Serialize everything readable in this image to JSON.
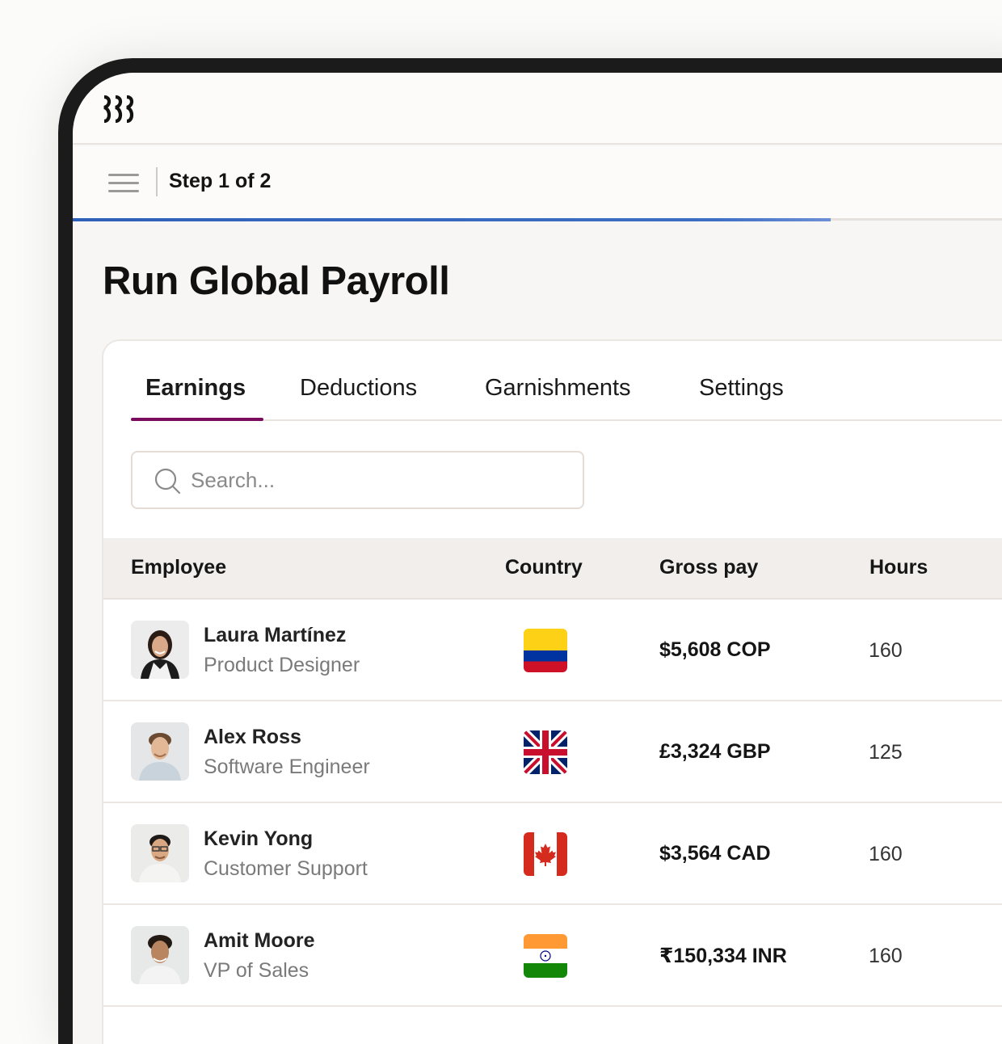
{
  "app": {
    "logo": "rippling-logo-icon"
  },
  "header": {
    "menu_icon": "hamburger-menu-icon",
    "step_text": "Step 1 of 2",
    "progress": 0.78
  },
  "page": {
    "title": "Run Global Payroll"
  },
  "tabs": [
    {
      "label": "Earnings",
      "active": true
    },
    {
      "label": "Deductions",
      "active": false
    },
    {
      "label": "Garnishments",
      "active": false
    },
    {
      "label": "Settings",
      "active": false
    }
  ],
  "search": {
    "placeholder": "Search...",
    "value": "",
    "icon": "search-icon"
  },
  "table": {
    "columns": [
      "Employee",
      "Country",
      "Gross pay",
      "Hours"
    ],
    "rows": [
      {
        "name": "Laura Martínez",
        "role": "Product Designer",
        "country_flag": "colombia-flag-icon",
        "gross_pay": "$5,608 COP",
        "hours": "160"
      },
      {
        "name": "Alex Ross",
        "role": "Software Engineer",
        "country_flag": "uk-flag-icon",
        "gross_pay": "£3,324 GBP",
        "hours": "125"
      },
      {
        "name": "Kevin Yong",
        "role": "Customer Support",
        "country_flag": "canada-flag-icon",
        "gross_pay": "$3,564 CAD",
        "hours": "160"
      },
      {
        "name": "Amit Moore",
        "role": "VP of Sales",
        "country_flag": "india-flag-icon",
        "gross_pay": "₹150,334 INR",
        "hours": "160"
      }
    ]
  },
  "colors": {
    "accent_progress": "#2f5fb8",
    "tab_underline": "#7b0b5d",
    "device_frame": "#1b1b1b"
  }
}
